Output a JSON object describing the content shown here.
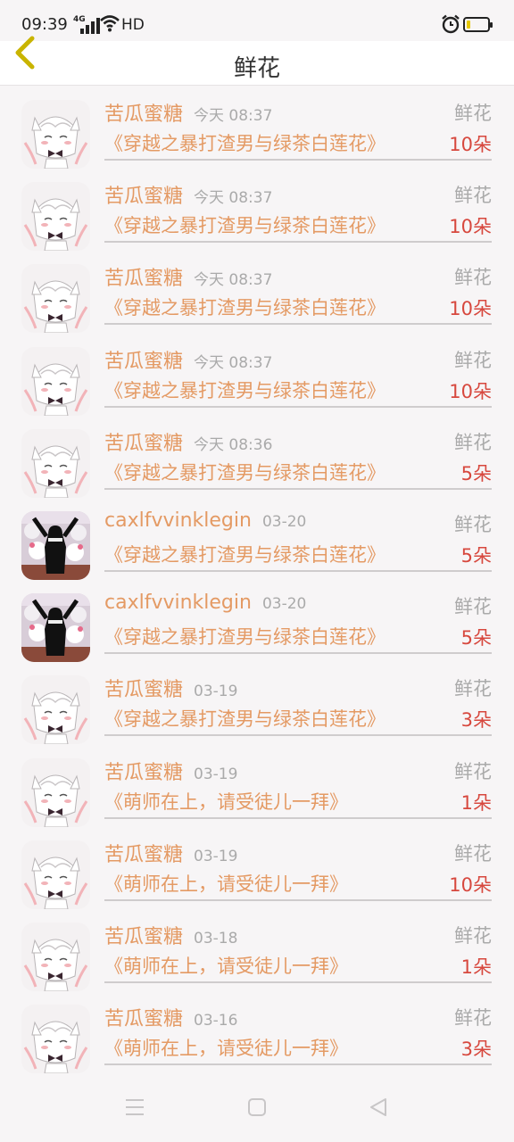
{
  "status": {
    "time": "09:39",
    "network": "4G",
    "hd": "HD"
  },
  "header": {
    "title": "鲜花"
  },
  "list": [
    {
      "avatar": "cat-girl",
      "name": "苦瓜蜜糖",
      "time": "今天 08:37",
      "type": "鲜花",
      "book": "《穿越之暴打渣男与绿茶白莲花》",
      "count": "10朵"
    },
    {
      "avatar": "cat-girl",
      "name": "苦瓜蜜糖",
      "time": "今天 08:37",
      "type": "鲜花",
      "book": "《穿越之暴打渣男与绿茶白莲花》",
      "count": "10朵"
    },
    {
      "avatar": "cat-girl",
      "name": "苦瓜蜜糖",
      "time": "今天 08:37",
      "type": "鲜花",
      "book": "《穿越之暴打渣男与绿茶白莲花》",
      "count": "10朵"
    },
    {
      "avatar": "cat-girl",
      "name": "苦瓜蜜糖",
      "time": "今天 08:37",
      "type": "鲜花",
      "book": "《穿越之暴打渣男与绿茶白莲花》",
      "count": "10朵"
    },
    {
      "avatar": "cat-girl",
      "name": "苦瓜蜜糖",
      "time": "今天 08:36",
      "type": "鲜花",
      "book": "《穿越之暴打渣男与绿茶白莲花》",
      "count": "5朵"
    },
    {
      "avatar": "photo",
      "name": "caxlfvvinklegin",
      "time": "03-20",
      "type": "鲜花",
      "book": "《穿越之暴打渣男与绿茶白莲花》",
      "count": "5朵"
    },
    {
      "avatar": "photo",
      "name": "caxlfvvinklegin",
      "time": "03-20",
      "type": "鲜花",
      "book": "《穿越之暴打渣男与绿茶白莲花》",
      "count": "5朵"
    },
    {
      "avatar": "cat-girl",
      "name": "苦瓜蜜糖",
      "time": "03-19",
      "type": "鲜花",
      "book": "《穿越之暴打渣男与绿茶白莲花》",
      "count": "3朵"
    },
    {
      "avatar": "cat-girl",
      "name": "苦瓜蜜糖",
      "time": "03-19",
      "type": "鲜花",
      "book": "《萌师在上，请受徒儿一拜》",
      "count": "1朵"
    },
    {
      "avatar": "cat-girl",
      "name": "苦瓜蜜糖",
      "time": "03-19",
      "type": "鲜花",
      "book": "《萌师在上，请受徒儿一拜》",
      "count": "10朵"
    },
    {
      "avatar": "cat-girl",
      "name": "苦瓜蜜糖",
      "time": "03-18",
      "type": "鲜花",
      "book": "《萌师在上，请受徒儿一拜》",
      "count": "1朵"
    },
    {
      "avatar": "cat-girl",
      "name": "苦瓜蜜糖",
      "time": "03-16",
      "type": "鲜花",
      "book": "《萌师在上，请受徒儿一拜》",
      "count": "3朵"
    }
  ],
  "colors": {
    "accent": "#e49a64",
    "count": "#d7483e",
    "muted": "#aaaaaa",
    "back_icon": "#c9b400"
  }
}
